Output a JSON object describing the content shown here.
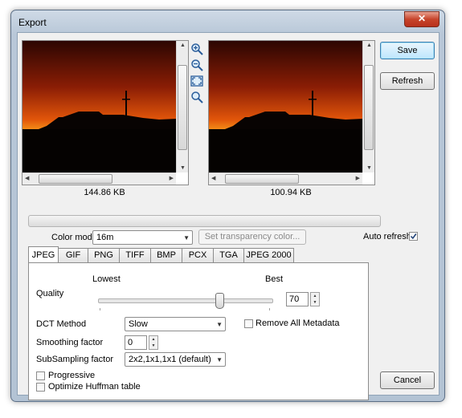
{
  "window": {
    "title": "Export",
    "close_label": "✕"
  },
  "previews": [
    {
      "size_label": "144.86 KB"
    },
    {
      "size_label": "100.94 KB"
    }
  ],
  "zoom_tools": [
    "zoom-in-icon",
    "zoom-out-icon",
    "fit-window-icon",
    "actual-size-icon"
  ],
  "buttons": {
    "save": "Save",
    "refresh": "Refresh",
    "cancel": "Cancel"
  },
  "color_mode": {
    "label": "Color mode",
    "value": "16m"
  },
  "transparency_button": "Set transparency color...",
  "auto_refresh": {
    "label": "Auto refresh",
    "checked": true
  },
  "tabs": [
    "JPEG",
    "GIF",
    "PNG",
    "TIFF",
    "BMP",
    "PCX",
    "TGA",
    "JPEG 2000"
  ],
  "active_tab": "JPEG",
  "jpeg": {
    "quality_label": "Quality",
    "lowest_label": "Lowest",
    "best_label": "Best",
    "quality_value": "70",
    "dct_label": "DCT Method",
    "dct_value": "Slow",
    "remove_metadata_label": "Remove All Metadata",
    "smoothing_label": "Smoothing factor",
    "smoothing_value": "0",
    "subsampling_label": "SubSampling factor",
    "subsampling_value": "2x2,1x1,1x1 (default)",
    "progressive_label": "Progressive",
    "optimize_label": "Optimize Huffman table"
  },
  "colors": {
    "accent": "#3c7fb1",
    "sky_top": "#3a0a02",
    "sky_glow": "#ff8a10"
  }
}
